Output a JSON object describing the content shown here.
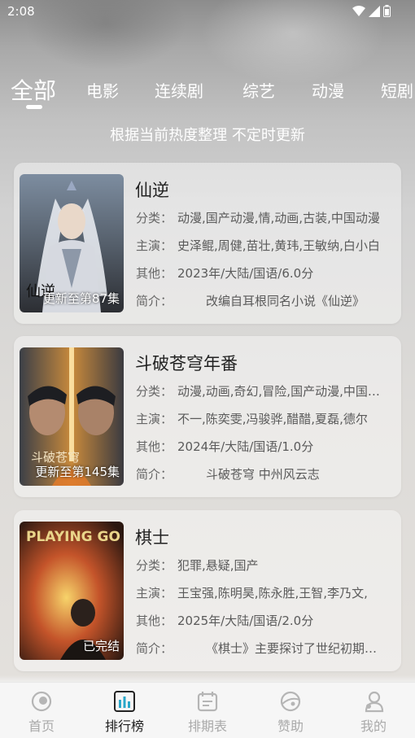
{
  "status_bar": {
    "time": "2:08"
  },
  "tabs": [
    {
      "label": "全部",
      "active": true
    },
    {
      "label": "电影",
      "active": false
    },
    {
      "label": "连续剧",
      "active": false
    },
    {
      "label": "综艺",
      "active": false
    },
    {
      "label": "动漫",
      "active": false
    },
    {
      "label": "短剧",
      "active": false
    }
  ],
  "subtitle": "根据当前热度整理 不定时更新",
  "cards": [
    {
      "title": "仙逆",
      "badge": "更新至第87集",
      "category_label": "分类：",
      "category": "动漫,国产动漫,情,动画,古装,中国动漫",
      "cast_label": "主演：",
      "cast": "史泽鲲,周健,苗壮,黄玮,王敏纳,白小白",
      "other_label": "其他：",
      "other": "2023年/大陆/国语/6.0分",
      "intro_label": "简介：",
      "intro": "改编自耳根同名小说《仙逆》"
    },
    {
      "title": "斗破苍穹年番",
      "badge": "更新至第145集",
      "category_label": "分类：",
      "category": "动漫,动画,奇幻,冒险,国产动漫,中国动漫",
      "cast_label": "主演：",
      "cast": "不一,陈奕雯,冯骏骅,醋醋,夏磊,德尔",
      "other_label": "其他：",
      "other": "2024年/大陆/国语/1.0分",
      "intro_label": "简介：",
      "intro": "斗破苍穹 中州风云志"
    },
    {
      "title": "棋士",
      "badge": "已完结",
      "category_label": "分类：",
      "category": "犯罪,悬疑,国产",
      "cast_label": "主演：",
      "cast": "王宝强,陈明昊,陈永胜,王智,李乃文,",
      "other_label": "其他：",
      "other": "2025年/大陆/国语/2.0分",
      "intro_label": "简介：",
      "intro": "《棋士》主要探讨了世纪初期的故事"
    }
  ],
  "poster_lettering": [
    "仙逆",
    "斗破苍穹",
    "PLAYING GO"
  ],
  "bottom_nav": [
    {
      "label": "首页",
      "icon": "home-icon",
      "active": false
    },
    {
      "label": "排行榜",
      "icon": "ranking-icon",
      "active": true
    },
    {
      "label": "排期表",
      "icon": "schedule-icon",
      "active": false
    },
    {
      "label": "赞助",
      "icon": "sponsor-icon",
      "active": false
    },
    {
      "label": "我的",
      "icon": "profile-icon",
      "active": false
    }
  ],
  "colors": {
    "active_nav": "#222222",
    "inactive_nav": "#aaaaaa",
    "text_white": "#ffffff"
  }
}
